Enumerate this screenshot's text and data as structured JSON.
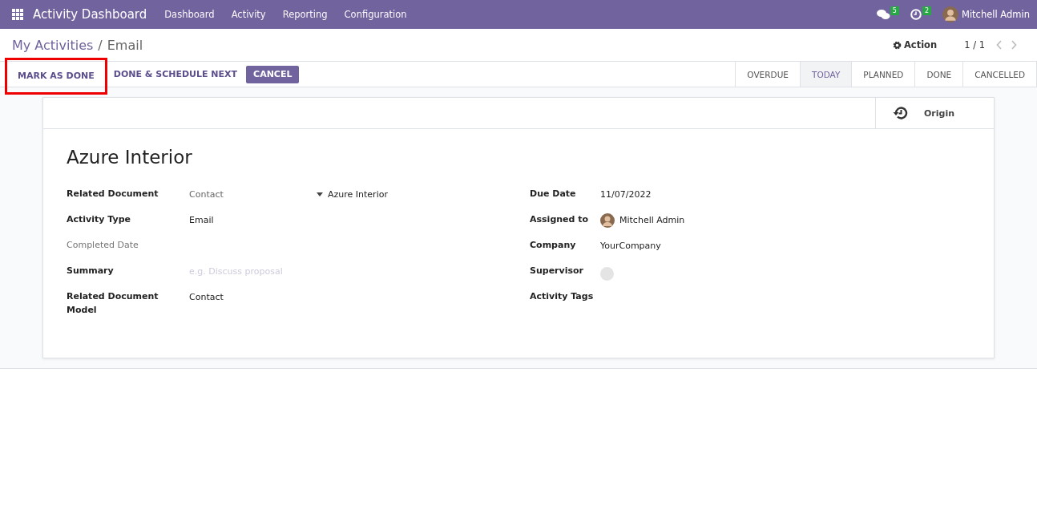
{
  "navbar": {
    "app_title": "Activity Dashboard",
    "menu": [
      "Dashboard",
      "Activity",
      "Reporting",
      "Configuration"
    ],
    "messages_count": "5",
    "activities_count": "2",
    "user": "Mitchell Admin"
  },
  "breadcrumb": {
    "parent": "My Activities",
    "separator": "/",
    "current": "Email"
  },
  "action_label": "Action",
  "pager": "1 / 1",
  "buttons": [
    {
      "label": "MARK AS DONE",
      "kind": "link",
      "highlighted": true
    },
    {
      "label": "DONE & SCHEDULE NEXT",
      "kind": "link",
      "highlighted": false
    },
    {
      "label": "CANCEL",
      "kind": "primary",
      "highlighted": false
    }
  ],
  "stages": [
    {
      "label": "OVERDUE",
      "selected": false
    },
    {
      "label": "TODAY",
      "selected": true
    },
    {
      "label": "PLANNED",
      "selected": false
    },
    {
      "label": "DONE",
      "selected": false
    },
    {
      "label": "CANCELLED",
      "selected": false
    }
  ],
  "smart_button": "Origin",
  "title": "Azure Interior",
  "left_fields": [
    {
      "label": "Related Document",
      "kind": "reference",
      "value": "Contact",
      "value2": "Azure Interior",
      "disabled": false
    },
    {
      "label": "Activity Type",
      "kind": "text",
      "value": "Email",
      "disabled": false
    },
    {
      "label": "Completed Date",
      "kind": "empty",
      "disabled": true
    },
    {
      "label": "Summary",
      "kind": "placeholder",
      "placeholder": "e.g. Discuss proposal",
      "disabled": false
    },
    {
      "label": "Related Document Model",
      "kind": "text",
      "value": "Contact",
      "disabled": false
    }
  ],
  "right_fields": [
    {
      "label": "Due Date",
      "kind": "text",
      "value": "11/07/2022",
      "disabled": false
    },
    {
      "label": "Assigned to",
      "kind": "avatar",
      "value": "Mitchell Admin",
      "disabled": false
    },
    {
      "label": "Company",
      "kind": "text",
      "value": "YourCompany",
      "disabled": false
    },
    {
      "label": "Supervisor",
      "kind": "empty_avatar",
      "disabled": false
    },
    {
      "label": "Activity Tags",
      "kind": "empty",
      "disabled": false
    }
  ]
}
